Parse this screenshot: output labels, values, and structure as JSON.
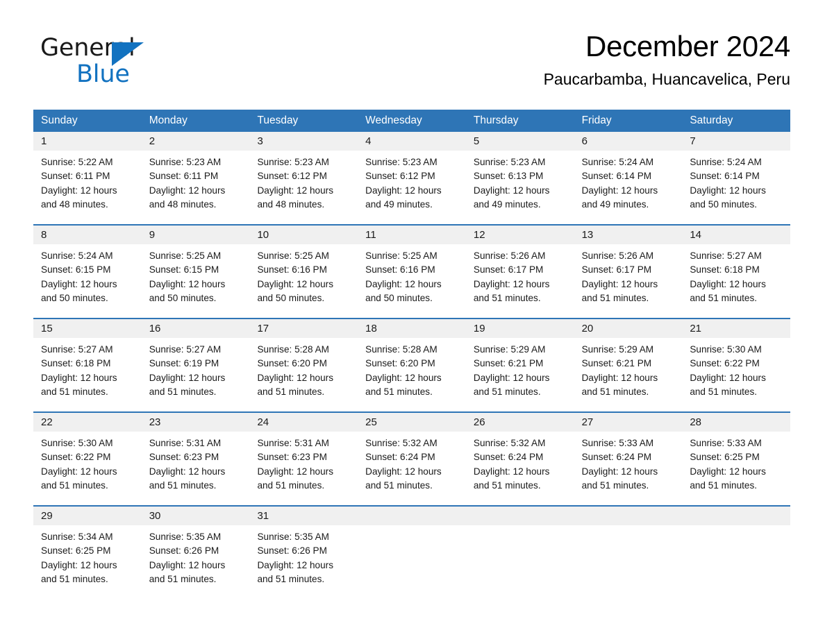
{
  "brand": {
    "name_part1": "General",
    "name_part2": "Blue",
    "triangle_color": "#1272c0",
    "text_color": "#1a1a1a"
  },
  "header": {
    "title": "December 2024",
    "subtitle": "Paucarbamba, Huancavelica, Peru"
  },
  "theme": {
    "header_blue": "#2e75b6",
    "day_band_gray": "#f0f0f0",
    "page_background": "#ffffff",
    "text": "#1a1a1a"
  },
  "calendar": {
    "weekdays": [
      "Sunday",
      "Monday",
      "Tuesday",
      "Wednesday",
      "Thursday",
      "Friday",
      "Saturday"
    ],
    "weeks": [
      [
        {
          "day": "1",
          "sunrise": "Sunrise: 5:22 AM",
          "sunset": "Sunset: 6:11 PM",
          "daylight": "Daylight: 12 hours and 48 minutes."
        },
        {
          "day": "2",
          "sunrise": "Sunrise: 5:23 AM",
          "sunset": "Sunset: 6:11 PM",
          "daylight": "Daylight: 12 hours and 48 minutes."
        },
        {
          "day": "3",
          "sunrise": "Sunrise: 5:23 AM",
          "sunset": "Sunset: 6:12 PM",
          "daylight": "Daylight: 12 hours and 48 minutes."
        },
        {
          "day": "4",
          "sunrise": "Sunrise: 5:23 AM",
          "sunset": "Sunset: 6:12 PM",
          "daylight": "Daylight: 12 hours and 49 minutes."
        },
        {
          "day": "5",
          "sunrise": "Sunrise: 5:23 AM",
          "sunset": "Sunset: 6:13 PM",
          "daylight": "Daylight: 12 hours and 49 minutes."
        },
        {
          "day": "6",
          "sunrise": "Sunrise: 5:24 AM",
          "sunset": "Sunset: 6:14 PM",
          "daylight": "Daylight: 12 hours and 49 minutes."
        },
        {
          "day": "7",
          "sunrise": "Sunrise: 5:24 AM",
          "sunset": "Sunset: 6:14 PM",
          "daylight": "Daylight: 12 hours and 50 minutes."
        }
      ],
      [
        {
          "day": "8",
          "sunrise": "Sunrise: 5:24 AM",
          "sunset": "Sunset: 6:15 PM",
          "daylight": "Daylight: 12 hours and 50 minutes."
        },
        {
          "day": "9",
          "sunrise": "Sunrise: 5:25 AM",
          "sunset": "Sunset: 6:15 PM",
          "daylight": "Daylight: 12 hours and 50 minutes."
        },
        {
          "day": "10",
          "sunrise": "Sunrise: 5:25 AM",
          "sunset": "Sunset: 6:16 PM",
          "daylight": "Daylight: 12 hours and 50 minutes."
        },
        {
          "day": "11",
          "sunrise": "Sunrise: 5:25 AM",
          "sunset": "Sunset: 6:16 PM",
          "daylight": "Daylight: 12 hours and 50 minutes."
        },
        {
          "day": "12",
          "sunrise": "Sunrise: 5:26 AM",
          "sunset": "Sunset: 6:17 PM",
          "daylight": "Daylight: 12 hours and 51 minutes."
        },
        {
          "day": "13",
          "sunrise": "Sunrise: 5:26 AM",
          "sunset": "Sunset: 6:17 PM",
          "daylight": "Daylight: 12 hours and 51 minutes."
        },
        {
          "day": "14",
          "sunrise": "Sunrise: 5:27 AM",
          "sunset": "Sunset: 6:18 PM",
          "daylight": "Daylight: 12 hours and 51 minutes."
        }
      ],
      [
        {
          "day": "15",
          "sunrise": "Sunrise: 5:27 AM",
          "sunset": "Sunset: 6:18 PM",
          "daylight": "Daylight: 12 hours and 51 minutes."
        },
        {
          "day": "16",
          "sunrise": "Sunrise: 5:27 AM",
          "sunset": "Sunset: 6:19 PM",
          "daylight": "Daylight: 12 hours and 51 minutes."
        },
        {
          "day": "17",
          "sunrise": "Sunrise: 5:28 AM",
          "sunset": "Sunset: 6:20 PM",
          "daylight": "Daylight: 12 hours and 51 minutes."
        },
        {
          "day": "18",
          "sunrise": "Sunrise: 5:28 AM",
          "sunset": "Sunset: 6:20 PM",
          "daylight": "Daylight: 12 hours and 51 minutes."
        },
        {
          "day": "19",
          "sunrise": "Sunrise: 5:29 AM",
          "sunset": "Sunset: 6:21 PM",
          "daylight": "Daylight: 12 hours and 51 minutes."
        },
        {
          "day": "20",
          "sunrise": "Sunrise: 5:29 AM",
          "sunset": "Sunset: 6:21 PM",
          "daylight": "Daylight: 12 hours and 51 minutes."
        },
        {
          "day": "21",
          "sunrise": "Sunrise: 5:30 AM",
          "sunset": "Sunset: 6:22 PM",
          "daylight": "Daylight: 12 hours and 51 minutes."
        }
      ],
      [
        {
          "day": "22",
          "sunrise": "Sunrise: 5:30 AM",
          "sunset": "Sunset: 6:22 PM",
          "daylight": "Daylight: 12 hours and 51 minutes."
        },
        {
          "day": "23",
          "sunrise": "Sunrise: 5:31 AM",
          "sunset": "Sunset: 6:23 PM",
          "daylight": "Daylight: 12 hours and 51 minutes."
        },
        {
          "day": "24",
          "sunrise": "Sunrise: 5:31 AM",
          "sunset": "Sunset: 6:23 PM",
          "daylight": "Daylight: 12 hours and 51 minutes."
        },
        {
          "day": "25",
          "sunrise": "Sunrise: 5:32 AM",
          "sunset": "Sunset: 6:24 PM",
          "daylight": "Daylight: 12 hours and 51 minutes."
        },
        {
          "day": "26",
          "sunrise": "Sunrise: 5:32 AM",
          "sunset": "Sunset: 6:24 PM",
          "daylight": "Daylight: 12 hours and 51 minutes."
        },
        {
          "day": "27",
          "sunrise": "Sunrise: 5:33 AM",
          "sunset": "Sunset: 6:24 PM",
          "daylight": "Daylight: 12 hours and 51 minutes."
        },
        {
          "day": "28",
          "sunrise": "Sunrise: 5:33 AM",
          "sunset": "Sunset: 6:25 PM",
          "daylight": "Daylight: 12 hours and 51 minutes."
        }
      ],
      [
        {
          "day": "29",
          "sunrise": "Sunrise: 5:34 AM",
          "sunset": "Sunset: 6:25 PM",
          "daylight": "Daylight: 12 hours and 51 minutes."
        },
        {
          "day": "30",
          "sunrise": "Sunrise: 5:35 AM",
          "sunset": "Sunset: 6:26 PM",
          "daylight": "Daylight: 12 hours and 51 minutes."
        },
        {
          "day": "31",
          "sunrise": "Sunrise: 5:35 AM",
          "sunset": "Sunset: 6:26 PM",
          "daylight": "Daylight: 12 hours and 51 minutes."
        },
        {
          "day": "",
          "sunrise": "",
          "sunset": "",
          "daylight": ""
        },
        {
          "day": "",
          "sunrise": "",
          "sunset": "",
          "daylight": ""
        },
        {
          "day": "",
          "sunrise": "",
          "sunset": "",
          "daylight": ""
        },
        {
          "day": "",
          "sunrise": "",
          "sunset": "",
          "daylight": ""
        }
      ]
    ]
  }
}
